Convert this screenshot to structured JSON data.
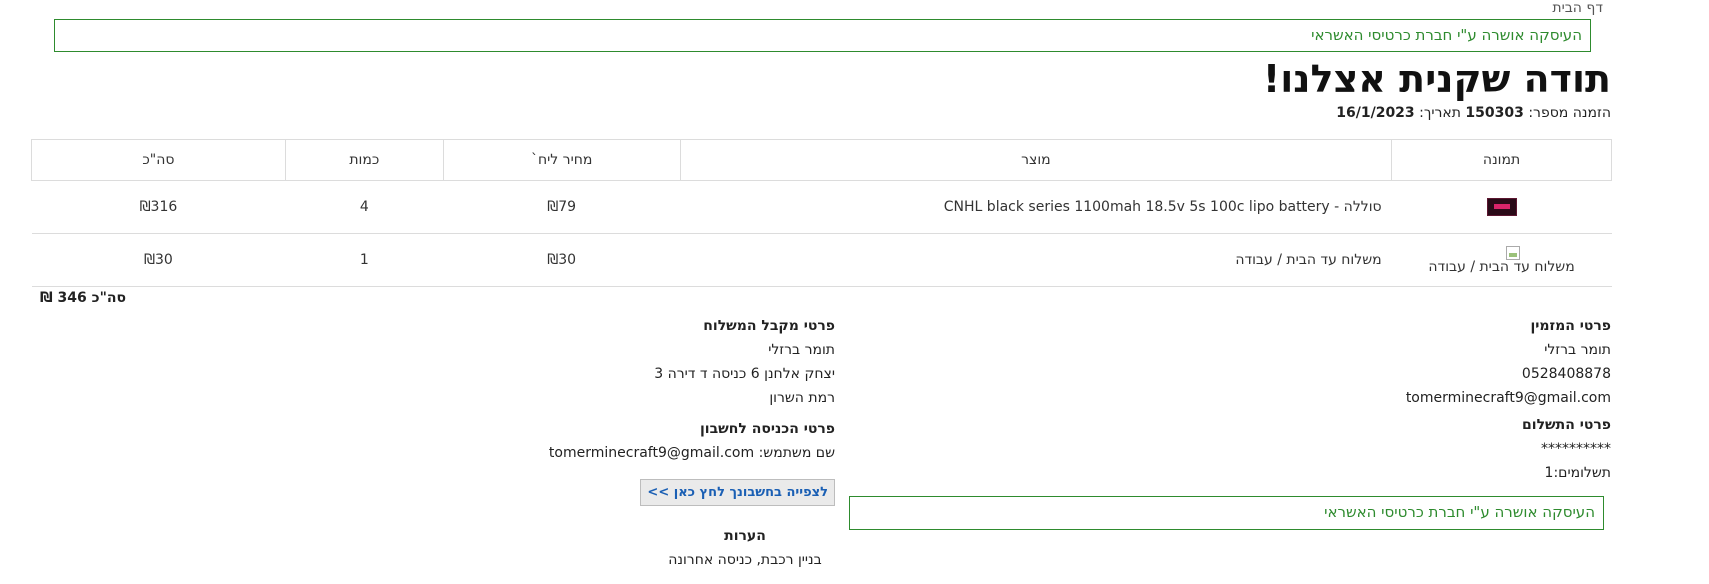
{
  "breadcrumb": "דף הבית",
  "banner_message": "העיסקה אושרה ע\"י חברת כרטיסי האשראי",
  "page_title": "תודה שקנית אצלנו!",
  "order": {
    "number_label": "הזמנה מספר:",
    "number": "150303",
    "date_label": "תאריך:",
    "date": "16/1/2023"
  },
  "table": {
    "headers": [
      "תמונה",
      "מוצר",
      "מחיר ליח`",
      "כמות",
      "סה\"כ"
    ],
    "rows": [
      {
        "image": "product-thumbnail",
        "product": "סוללה - CNHL black series 1100mah 18.5v 5s 100c lipo battery",
        "unit_price": "₪79",
        "quantity": "4",
        "total": "₪316"
      },
      {
        "image_alt": "משלוח עד הבית / עבודה",
        "product": "משלוח עד הבית / עבודה",
        "unit_price": "₪30",
        "quantity": "1",
        "total": "₪30"
      }
    ]
  },
  "grand_total": "סה\"כ 346 ₪",
  "customer": {
    "title": "פרטי המזמין",
    "name": "תומר ברזלי",
    "phone": "0528408878",
    "email": "tomerminecraft9@gmail.com"
  },
  "payment": {
    "title": "פרטי התשלום",
    "card_masked": "**********",
    "installments": "תשלומים:1"
  },
  "recipient": {
    "title": "פרטי מקבל המשלוח",
    "name": "תומר ברזלי",
    "address": "יצחק אלחנן 6 כניסה ד דירה 3",
    "city": "רמת השרון"
  },
  "account": {
    "title": "פרטי הכניסה לחשבון",
    "username_label": "שם משתמש:",
    "username": "tomerminecraft9@gmail.com",
    "view_account_button": "לצפייה בחשבונך לחץ כאן >>"
  },
  "notes": {
    "title": "הערות",
    "text": "בניין רכבת, כניסה אחרונה"
  },
  "colors": {
    "success": "#2e8b2e",
    "link": "#1a5fb4"
  }
}
